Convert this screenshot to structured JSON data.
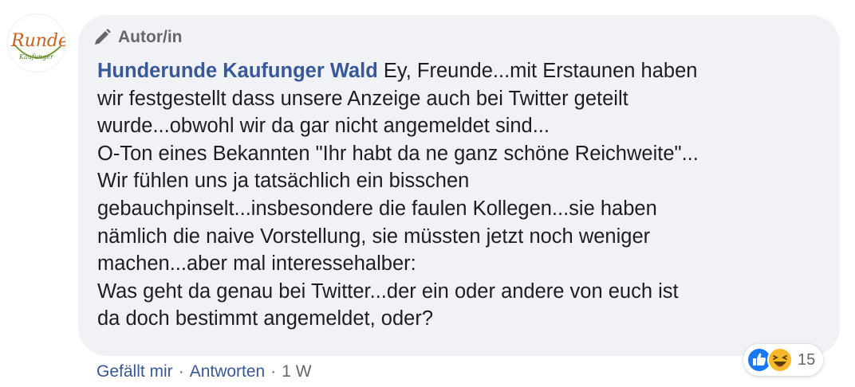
{
  "author_badge": {
    "label": "Autor/in",
    "icon": "pencil-icon"
  },
  "avatar": {
    "logo_text": "Runde",
    "logo_subtext": "Kaufunger"
  },
  "comment": {
    "author_name": "Hunderunde Kaufunger Wald",
    "lines": [
      " Ey, Freunde...mit Erstaunen haben",
      "wir festgestellt dass unsere Anzeige auch bei Twitter geteilt",
      "wurde...obwohl wir da gar nicht angemeldet sind...",
      "O-Ton eines Bekannten \"Ihr habt da ne ganz schöne Reichweite\"...",
      "Wir fühlen uns ja tatsächlich ein bisschen",
      "gebauchpinselt...insbesondere die faulen Kollegen...sie haben",
      "nämlich die naive Vorstellung, sie müssten jetzt noch weniger",
      "machen...aber mal interessehalber:",
      "Was geht da genau bei Twitter...der ein oder andere von euch ist",
      "da doch bestimmt angemeldet, oder?"
    ]
  },
  "reactions": {
    "icons": [
      "like-icon",
      "haha-icon"
    ],
    "count": "15"
  },
  "actions": {
    "like": "Gefällt mir",
    "reply": "Antworten",
    "separator": "·",
    "time": "1 W"
  },
  "colors": {
    "bubble": "#f0f2f5",
    "link": "#385898",
    "meta": "#65676b",
    "like_blue": "#1877f2",
    "haha_yellow": "#f7b928"
  }
}
